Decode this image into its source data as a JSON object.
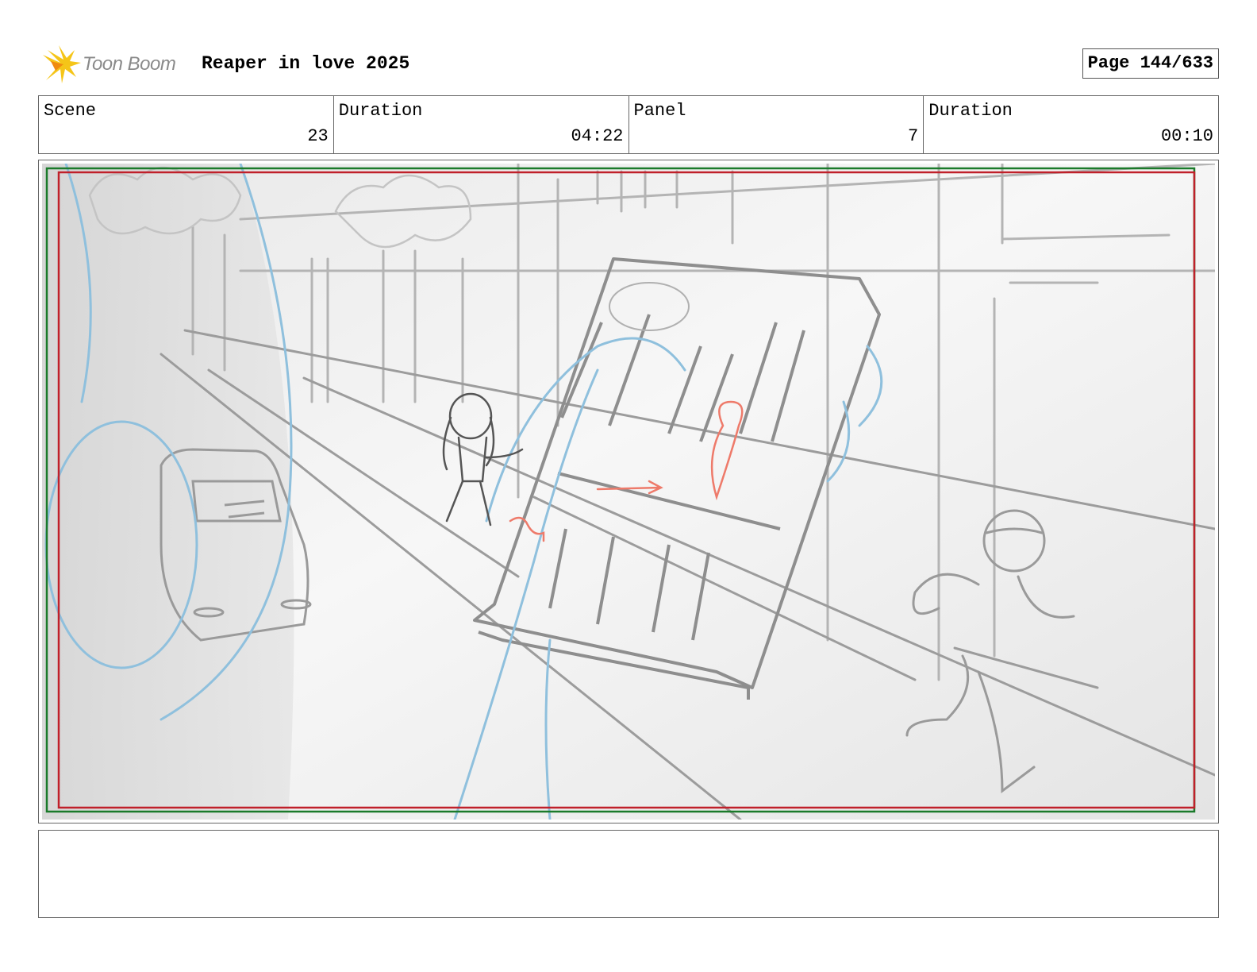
{
  "header": {
    "logo_text": "Toon Boom",
    "project_title": "Reaper in love 2025",
    "page_label": "Page 144/633"
  },
  "info": {
    "scene_label": "Scene",
    "scene_value": "23",
    "scene_duration_label": "Duration",
    "scene_duration_value": "04:22",
    "panel_label": "Panel",
    "panel_value": "7",
    "panel_duration_label": "Duration",
    "panel_duration_value": "00:10"
  },
  "panel": {
    "safe_frame_color": "#1a7a2a",
    "action_frame_color": "#c0202a"
  },
  "notes": {
    "text": ""
  }
}
